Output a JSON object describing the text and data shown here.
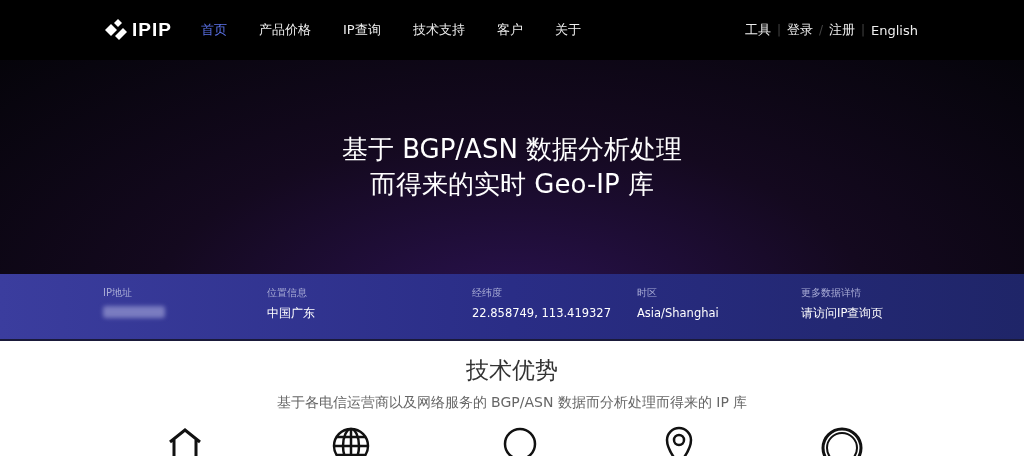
{
  "nav": {
    "logo": "IPIP",
    "items": [
      {
        "label": "首页",
        "selected": true
      },
      {
        "label": "产品价格",
        "selected": false
      },
      {
        "label": "IP查询",
        "selected": false
      },
      {
        "label": "技术支持",
        "selected": false
      },
      {
        "label": "客户",
        "selected": false
      },
      {
        "label": "关于",
        "selected": false
      }
    ],
    "right": [
      {
        "kind": "link",
        "text": "工具"
      },
      {
        "kind": "sep",
        "text": "|"
      },
      {
        "kind": "link",
        "text": "登录"
      },
      {
        "kind": "sep",
        "text": "/"
      },
      {
        "kind": "link",
        "text": "注册"
      },
      {
        "kind": "sep",
        "text": "|"
      },
      {
        "kind": "link",
        "text": "English"
      }
    ]
  },
  "hero": {
    "lines": [
      "基于 BGP/ASN 数据分析处理",
      "而得来的实时 Geo-IP 库"
    ]
  },
  "info": [
    {
      "label": "IP地址",
      "kind": "blurred"
    },
    {
      "label": "位置信息",
      "kind": "text",
      "value": "中国广东"
    },
    {
      "label": "经纬度",
      "kind": "text",
      "value": "22.858749, 113.419327"
    },
    {
      "label": "时区",
      "kind": "text",
      "value": "Asia/Shanghai"
    },
    {
      "label": "更多数据详情",
      "kind": "link",
      "value": "请访问IP查询页"
    }
  ],
  "features": {
    "title": "技术优势",
    "subtitle": "基于各电信运营商以及网络服务的 BGP/ASN 数据而分析处理而得来的 IP 库",
    "icons": [
      {
        "kind": "house"
      },
      {
        "kind": "globe"
      },
      {
        "kind": "circle"
      },
      {
        "kind": "pin"
      },
      {
        "kind": "ring"
      }
    ]
  }
}
